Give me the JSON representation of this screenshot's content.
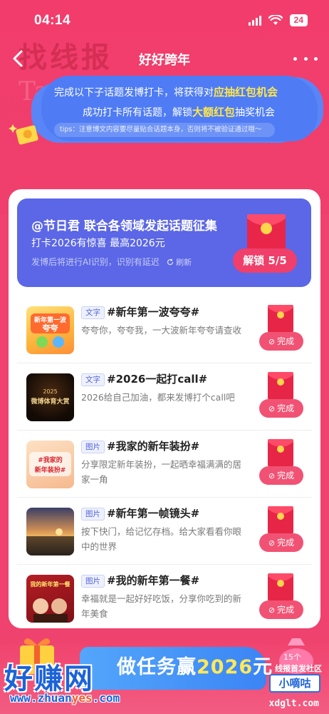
{
  "status_bar": {
    "time": "04:14",
    "battery": "24"
  },
  "nav": {
    "title": "好好跨年"
  },
  "watermarks": {
    "top": "找线报",
    "taobao": "Taobao",
    "bottom_brand": "好赚网",
    "bottom_url_prefix": "www.zhuan",
    "bottom_url_mid": "yes",
    "bottom_url_suffix": ".com",
    "right_label": "线报首发社区",
    "right_box": "小嘀咕",
    "right_url": "xdglt.com"
  },
  "banner": {
    "line1_prefix": "完成以下子话题发博打卡，将获得对",
    "line1_highlight": "应抽红包机会",
    "line2_prefix": "成功打卡所有话题，解锁",
    "line2_highlight": "大额红包",
    "line2_suffix": "抽奖机会",
    "tips": "tips：注意博文内容要尽量贴合话题本身，否则将不被验证通过哦～"
  },
  "promo": {
    "title": "@节日君 联合各领域发起话题征集",
    "subtitle": "打卡2026有惊喜 最高2026元",
    "note": "发博后将进行AI识别，识别有延迟",
    "refresh": "刷新",
    "unlock_label": "解锁 5/5"
  },
  "tasks": [
    {
      "tag": "文字",
      "title": "#新年第一波夸夸#",
      "desc": "夸夸你，夸夸我，一大波新年夸夸请查收",
      "thumb_text": "新年第一波夸夸",
      "done": "完成"
    },
    {
      "tag": "文字",
      "title": "#2026一起打call#",
      "desc": "2026给自己加油，都来发博打个call吧",
      "thumb_text": "微博体育大赏",
      "thumb_year": "2025",
      "done": "完成"
    },
    {
      "tag": "图片",
      "title": "#我家的新年装扮#",
      "desc": "分享限定新年装扮，一起晒幸福满满的居家一角",
      "thumb_text": "#我家的新年装扮#",
      "done": "完成"
    },
    {
      "tag": "图片",
      "title": "#新年第一帧镜头#",
      "desc": "按下快门，给记忆存档。给大家看看你眼中的世界",
      "done": "完成"
    },
    {
      "tag": "图片",
      "title": "#我的新年第一餐#",
      "desc": "幸福就是一起好好吃饭，分享你吃到的新年美食",
      "thumb_text": "我的新年第一餐",
      "done": "完成"
    }
  ],
  "bottom": {
    "text_prefix": "做任务赢",
    "text_num": "2026",
    "text_suffix": "元",
    "badge": "15个"
  },
  "colors": {
    "background": "#f0426e",
    "banner": "#4f7cf5",
    "promo": "#5b67e6",
    "accent_red": "#ef3f6a",
    "highlight_yellow": "#ffe74a"
  }
}
